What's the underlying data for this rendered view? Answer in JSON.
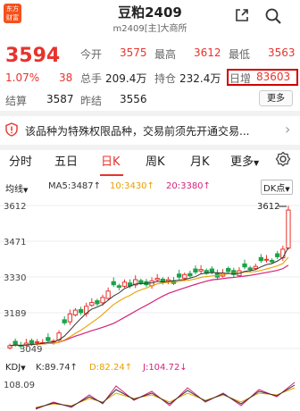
{
  "header": {
    "logo_line1": "东方",
    "logo_line2": "财富",
    "title": "豆粕2409",
    "subtitle": "m2409[主]大商所"
  },
  "quote": {
    "price": "3594",
    "change_pct": "1.07%",
    "change": "38",
    "open_label": "今开",
    "open": "3575",
    "high_label": "最高",
    "high": "3612",
    "low_label": "最低",
    "low": "3563",
    "volume_label": "总手",
    "volume": "209.4万",
    "oi_label": "持仓",
    "oi": "232.4万",
    "daily_inc_label": "日增",
    "daily_inc": "83603",
    "settle_label": "结算",
    "settle": "3587",
    "prev_settle_label": "昨结",
    "prev_settle": "3556",
    "more": "更多"
  },
  "notice": {
    "text": "该品种为特殊权限品种，交易前须先开通交易..."
  },
  "tabs": [
    "分时",
    "五日",
    "日K",
    "周K",
    "月K",
    "更多"
  ],
  "active_tab": "日K",
  "indicators": {
    "ma_type": "均线",
    "ma5": "MA5:3487↑",
    "ma10": "10:3430↑",
    "ma20": "20:3380↑",
    "dk": "DK点"
  },
  "axis": {
    "y_labels": [
      "3612",
      "3471",
      "3330",
      "3189",
      "3049"
    ],
    "high_marker": "3612"
  },
  "kdj": {
    "label": "KDJ",
    "k": "K:89.74↑",
    "d": "D:82.24↑",
    "j": "J:104.72↓",
    "top_label": "108.09"
  },
  "colors": {
    "up": "#e8332d",
    "down": "#1aa34a",
    "ma5": "#333333",
    "ma10": "#e8a000",
    "ma20": "#d4237a"
  }
}
